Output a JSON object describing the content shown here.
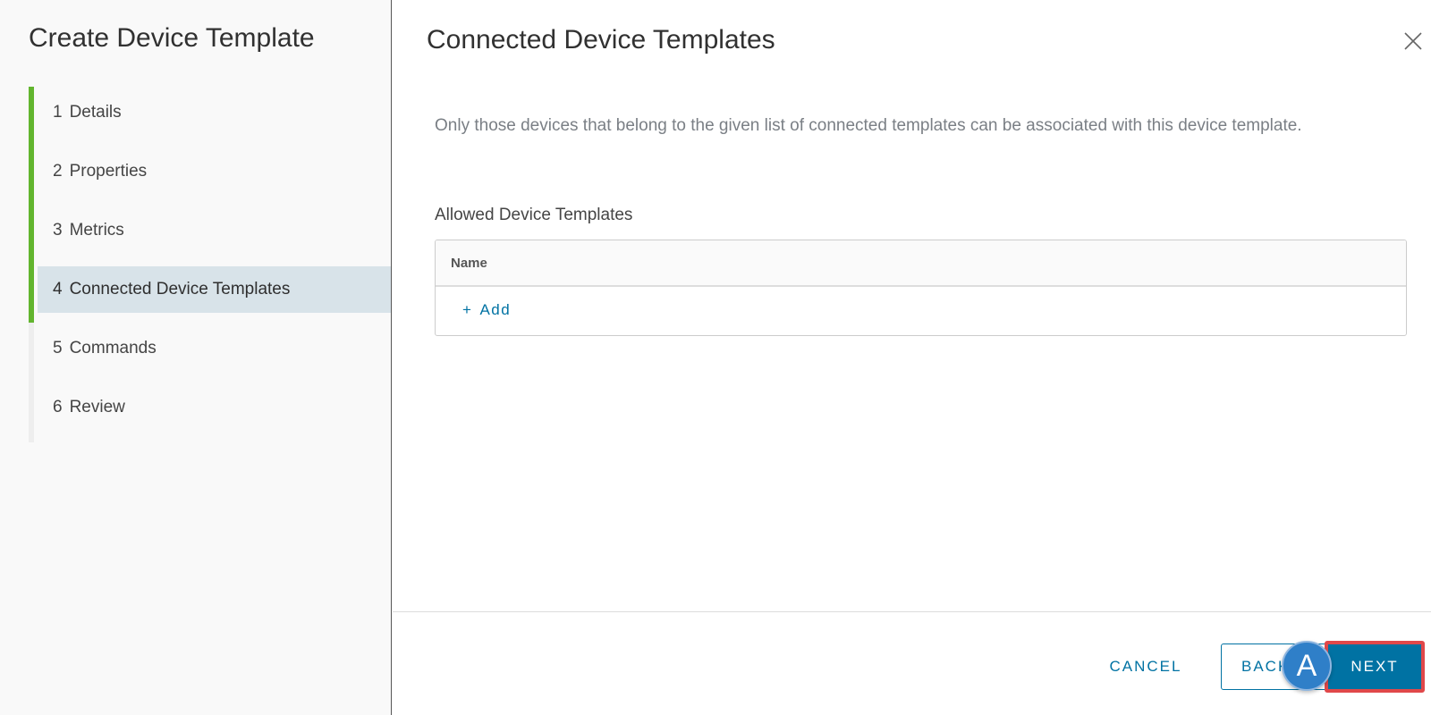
{
  "sidebar": {
    "title": "Create Device Template",
    "steps": [
      {
        "num": "1",
        "label": "Details"
      },
      {
        "num": "2",
        "label": "Properties"
      },
      {
        "num": "3",
        "label": "Metrics"
      },
      {
        "num": "4",
        "label": "Connected Device Templates"
      },
      {
        "num": "5",
        "label": "Commands"
      },
      {
        "num": "6",
        "label": "Review"
      }
    ],
    "active_step": 4
  },
  "main": {
    "title": "Connected Device Templates",
    "description": "Only those devices that belong to the given list of connected templates can be associated with this device template.",
    "section_label": "Allowed Device Templates",
    "grid": {
      "columns": [
        "Name"
      ],
      "add_label": "Add",
      "add_icon": "+"
    }
  },
  "footer": {
    "cancel_label": "CANCEL",
    "back_label": "BACK",
    "next_label": "NEXT"
  },
  "annotation_marker": "A",
  "colors": {
    "accent": "#0072a3",
    "progress": "#62b52e",
    "active_step_bg": "#d8e3e9",
    "highlight": "#e0484a",
    "marker": "#2f7fc8"
  }
}
